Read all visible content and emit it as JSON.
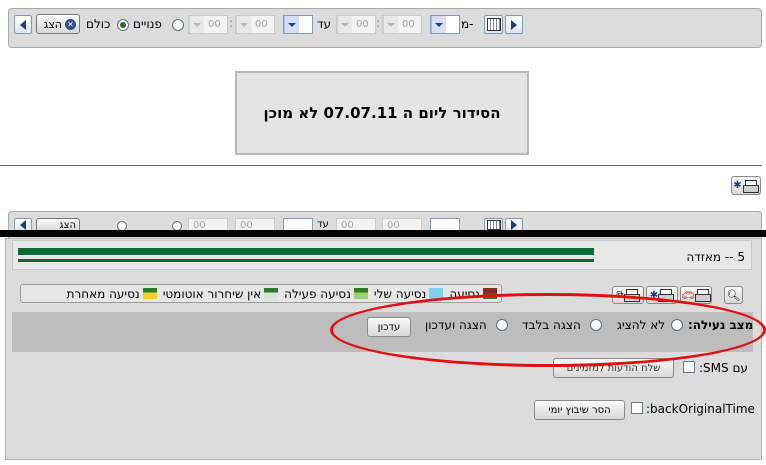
{
  "toolbar": {
    "from_label": "מ-",
    "to_label": "עד",
    "hour_from": "00",
    "min_from": "00",
    "hour_to": "00",
    "min_to": "00",
    "radio_all": "כולם",
    "radio_free": "פנויים",
    "show_button": "הצג",
    "time_sep": ":"
  },
  "message": {
    "text": "הסידור ליום ה 07.07.11 לא מוכן"
  },
  "lower_toolbar": {
    "show_button": "הצג",
    "to_label": "עד",
    "hour_from": "00",
    "min_from": "00",
    "hour_to": "00",
    "min_to": "00"
  },
  "section": {
    "title": "5 -- מאזדה",
    "bar_color": "#0b6b35"
  },
  "legend": {
    "items": [
      {
        "label": "נסיעה",
        "color": "#8b2a1f",
        "color2": "#2f7a2a"
      },
      {
        "label": "נסיעה שלי",
        "color": "#7fd0f0"
      },
      {
        "label": "נסיעה פעילה",
        "color": "#2f7a2a",
        "color2": "#9bd46b"
      },
      {
        "label": "אין שיחרור אוטומטי",
        "color": "#2f7a2a",
        "color2": "#d8e6d8"
      },
      {
        "label": "נסיעה מאחרת",
        "color": "#2f7a2a",
        "color2": "#f3d02c"
      }
    ]
  },
  "lock_state": {
    "label": "מצב נעילה:",
    "options": [
      "לא להציג",
      "הצגה בלבד",
      "הצגה ועדכון"
    ],
    "update_button": "עדכון"
  },
  "sms": {
    "label": "עם SMS:",
    "send_button": "שלח הודעות למזמינים"
  },
  "back_original": {
    "label": "backOriginalTime:",
    "remove_button": "הסר שיבוץ יומי"
  },
  "colors": {
    "annotation_ellipse": "#e11010",
    "calendar_arrow": "#1c3d7a"
  }
}
